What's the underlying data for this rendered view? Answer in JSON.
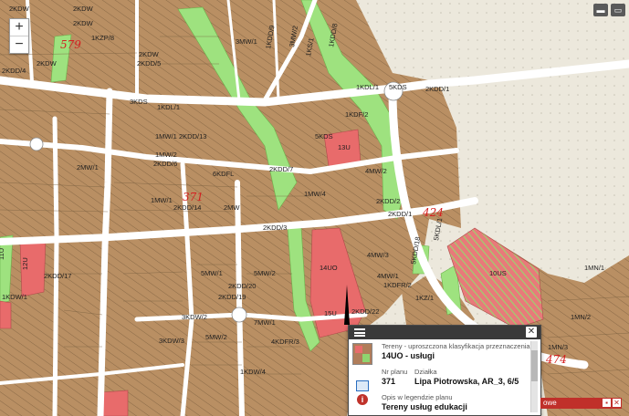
{
  "map": {
    "zoom_in": "+",
    "zoom_out": "−",
    "plan_numbers": [
      "579",
      "371",
      "424",
      "474"
    ],
    "labels": [
      "2KDW",
      "2KDW",
      "2KDW",
      "2KDW",
      "3MW/1",
      "3MW/2",
      "1KS/1",
      "1KDD/9",
      "1KDD/8",
      "1KZP/8",
      "2KDW",
      "2KDD/5",
      "2KDD/4",
      "3KDS",
      "1KDL/1",
      "5KDS",
      "2KDD/1",
      "1KDL/1",
      "1MW/1",
      "1MW/2",
      "2KDD/13",
      "2KDD/6",
      "2KDD/7",
      "6KDFL",
      "5KDS",
      "1MW/1",
      "2KDD/14",
      "2MW",
      "2KDD/3",
      "2KDD/2",
      "2KDD/1",
      "13U",
      "14UO",
      "15U",
      "4MW/3",
      "4MW/1",
      "10US",
      "2KDD/22",
      "2KDD/17",
      "12U",
      "11U",
      "2KDD/19",
      "3KDW/2",
      "3KDW/3",
      "2KDD/20",
      "4KDFR/3",
      "1KDFR/2",
      "1KDW/1",
      "5MW/1",
      "5MW/2",
      "7MW/1",
      "1MN/2",
      "1MN/3",
      "5MW/2",
      "4MW/2",
      "5KDL/1",
      "5KDD/18",
      "2MW/1",
      "1MW/4",
      "1KDW/4",
      "1KZ/1",
      "1MN/1",
      "1KDF/2"
    ]
  },
  "toolbar": {
    "btn1_icon": "comment-icon",
    "btn2_icon": "monitor-icon"
  },
  "popup": {
    "layer_label": "Tereny - uproszczona klasyfikacja przeznaczenia",
    "zone_value": "14UO - usługi",
    "plan_label": "Nr planu",
    "plot_label": "Działka",
    "plan_value": "371",
    "plot_value": "Lipa Piotrowska, AR_3, 6/5",
    "legend_label": "Opis w legendzie planu",
    "legend_value": "Tereny usług edukacji"
  },
  "statusbar": {
    "label": "owe"
  }
}
